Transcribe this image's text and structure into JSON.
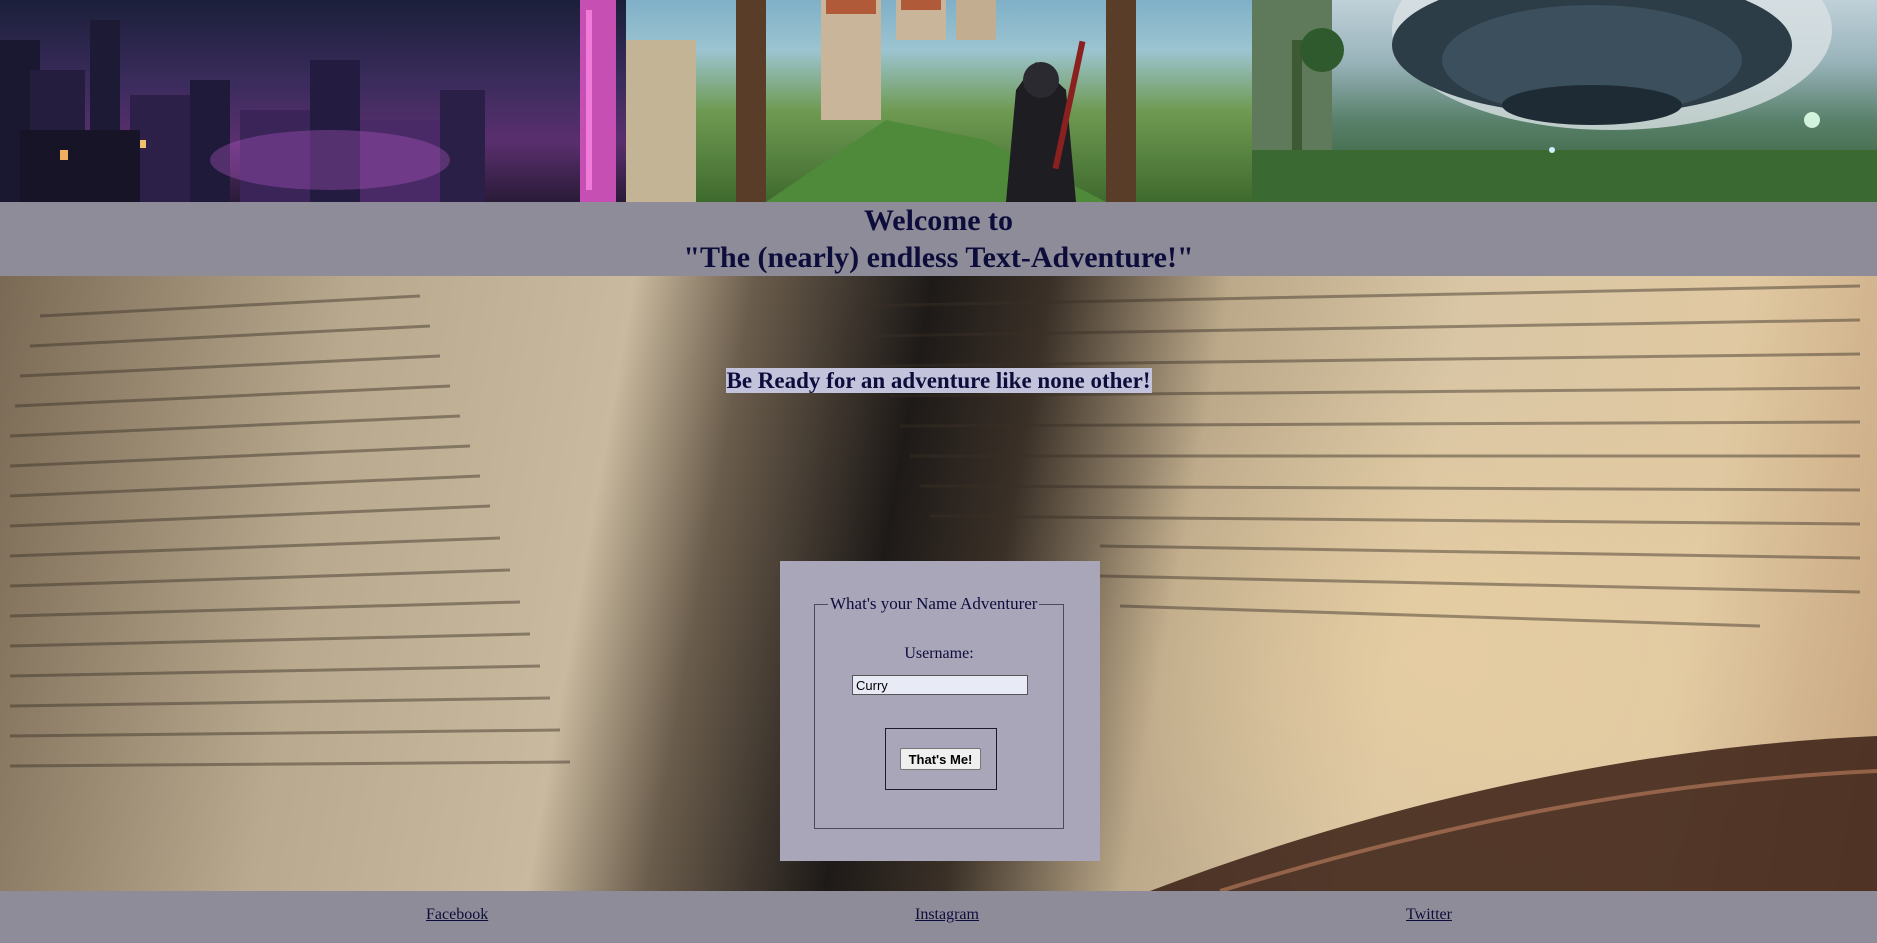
{
  "banner": {
    "panels": [
      {
        "name": "cyberpunk-city-panel"
      },
      {
        "name": "castle-knight-panel"
      },
      {
        "name": "alien-forest-panel"
      }
    ]
  },
  "header": {
    "title_line_1": "Welcome to",
    "title_line_2": "\"The (nearly) endless Text-Adventure!\""
  },
  "main": {
    "tagline": "Be Ready for an adventure like none other!"
  },
  "login_form": {
    "legend": "What's your Name Adventurer",
    "username_label": "Username:",
    "username_value": "Curry",
    "submit_label": "That's Me!"
  },
  "footer": {
    "links": [
      {
        "label": "Facebook"
      },
      {
        "label": "Instagram"
      },
      {
        "label": "Twitter"
      }
    ]
  },
  "colors": {
    "title_text": "#0d0d3b",
    "bar_background": "#8e8c98",
    "card_background": "#a8a6b8",
    "tagline_highlight": "#c4c3dc"
  }
}
